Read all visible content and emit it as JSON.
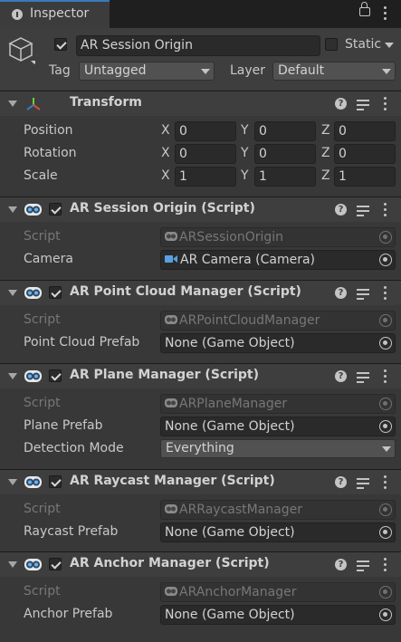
{
  "tab": {
    "label": "Inspector"
  },
  "object": {
    "name": "AR Session Origin",
    "active": true,
    "static_label": "Static",
    "static_checked": false,
    "tag_label": "Tag",
    "tag_value": "Untagged",
    "layer_label": "Layer",
    "layer_value": "Default"
  },
  "transform": {
    "title": "Transform",
    "position_label": "Position",
    "rotation_label": "Rotation",
    "scale_label": "Scale",
    "axis_x": "X",
    "axis_y": "Y",
    "axis_z": "Z",
    "position": {
      "x": "0",
      "y": "0",
      "z": "0"
    },
    "rotation": {
      "x": "0",
      "y": "0",
      "z": "0"
    },
    "scale": {
      "x": "1",
      "y": "1",
      "z": "1"
    }
  },
  "components": [
    {
      "title": "AR Session Origin (Script)",
      "enabled": true,
      "script_label": "Script",
      "script_value": "ARSessionOrigin",
      "field_label": "Camera",
      "field_value": "AR Camera (Camera)"
    },
    {
      "title": "AR Point Cloud Manager (Script)",
      "enabled": true,
      "script_label": "Script",
      "script_value": "ARPointCloudManager",
      "field_label": "Point Cloud Prefab",
      "field_value": "None (Game Object)"
    },
    {
      "title": "AR Plane Manager (Script)",
      "enabled": true,
      "script_label": "Script",
      "script_value": "ARPlaneManager",
      "field_label": "Plane Prefab",
      "field_value": "None (Game Object)",
      "extra_label": "Detection Mode",
      "extra_value": "Everything"
    },
    {
      "title": "AR Raycast Manager (Script)",
      "enabled": true,
      "script_label": "Script",
      "script_value": "ARRaycastManager",
      "field_label": "Raycast Prefab",
      "field_value": "None (Game Object)"
    },
    {
      "title": "AR Anchor Manager (Script)",
      "enabled": true,
      "script_label": "Script",
      "script_value": "ARAnchorManager",
      "field_label": "Anchor Prefab",
      "field_value": "None (Game Object)"
    }
  ],
  "colors": {
    "accent": "#3a79bb",
    "panel": "#383838",
    "header": "#3e3e3e",
    "field": "#2a2a2a"
  }
}
